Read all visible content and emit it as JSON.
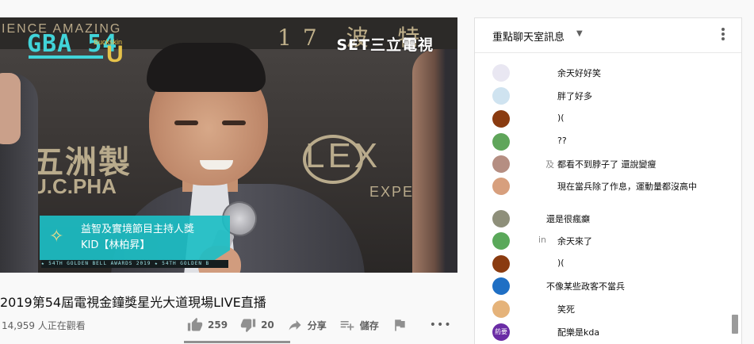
{
  "player": {
    "backdrop_top_left": "IENCE AMAZING",
    "backdrop_top_right": "17 波 特",
    "backdrop_big_left": "五洲製",
    "backdrop_big_left_sub": "U.C.PHA",
    "backdrop_big_right": "LEX",
    "backdrop_big_right_sub": "EXPER",
    "logo_left_main": "GBA 54",
    "logo_left_brand": "Buckskin",
    "logo_left_u": "U",
    "channel_logo": "SET三立電視",
    "lower_third": {
      "line1": "益智及實境節目主持人獎",
      "line2": "KID【林柏昇】",
      "strip": "★ 54TH GOLDEN BELL AWARDS 2019 ★ 54TH GOLDEN B"
    }
  },
  "video": {
    "title": "2019第54屆電視金鐘獎星光大道現場LIVE直播",
    "view_count": "14,959 人正在觀看",
    "actions": {
      "like_count": "259",
      "dislike_count": "20",
      "share_label": "分享",
      "save_label": "儲存",
      "more_label": "•••"
    }
  },
  "chat": {
    "title": "重點聊天室訊息",
    "messages": [
      {
        "author": "",
        "text": "余天好好笑",
        "avatar_color": "#e9e7f2"
      },
      {
        "author": "",
        "text": "胖了好多",
        "avatar_color": "#cfe3f0"
      },
      {
        "author": "",
        "text": ")(",
        "avatar_color": "#8a3b10"
      },
      {
        "author": "",
        "text": "??",
        "avatar_color": "#5fa55a"
      },
      {
        "author": "及",
        "text": "都看不到脖子了 還說變瘦",
        "avatar_color": "#b58e82"
      },
      {
        "author": "",
        "text": "現在當兵除了作息，運動量都沒高中",
        "avatar_color": "#d79f7d"
      },
      {
        "author": "",
        "text": "還是很瘋癲",
        "avatar_color": "#8e8f7a"
      },
      {
        "author": "in",
        "text": "余天來了",
        "avatar_color": "#5aa85a"
      },
      {
        "author": "",
        "text": ")(",
        "avatar_color": "#8a3b10"
      },
      {
        "author": "",
        "text": "不像某些政客不當兵",
        "avatar_color": "#1f6fc4"
      },
      {
        "author": "",
        "text": "笑死",
        "avatar_color": "#e5b37a"
      },
      {
        "author": "",
        "text": "配樂是kda",
        "avatar_color": "#6a2ca5",
        "avatar_text": "葯要"
      }
    ]
  },
  "colors": {
    "accent_teal": "#1cbec4",
    "chat_bg": "#ffffff",
    "page_bg": "#f9f9f9"
  }
}
